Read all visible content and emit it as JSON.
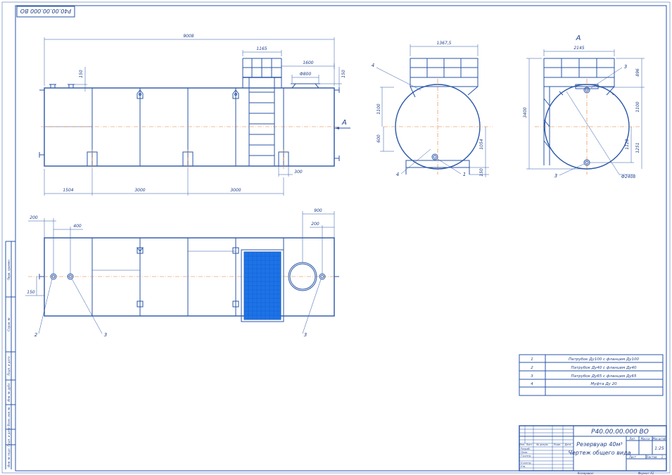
{
  "stamp_code": "Р40.00.00.000 ВО",
  "dimensions": {
    "total_length": "9008",
    "ladder_width": "1165",
    "platform_length": "1600",
    "hatch_dia": "Ф800",
    "top_left_150": "150",
    "top_right_150": "150",
    "support_300": "300",
    "bottom_1504": "1504",
    "bottom_3000_a": "3000",
    "bottom_3000_b": "3000",
    "mid_1367": "1367,5",
    "mid_1100": "1100",
    "mid_600": "600",
    "mid_1054": "1054",
    "mid_150": "150",
    "right_2145": "2145",
    "right_3400": "3400",
    "right_896": "896",
    "right_1100": "1100",
    "right_1120": "1120",
    "right_1251": "1251",
    "right_dia": "Ф2408",
    "plan_200a": "200",
    "plan_400": "400",
    "plan_900": "900",
    "plan_200b": "200",
    "plan_150": "150"
  },
  "section_letter": "А",
  "section_arrow_letter": "А",
  "callouts": {
    "mid_4_top": "4",
    "mid_4_bottom": "4",
    "mid_1": "1",
    "right_3_top": "3",
    "right_3_bottom": "3",
    "plan_2": "2",
    "plan_3a": "3",
    "plan_3b": "3"
  },
  "specification": [
    {
      "num": "1",
      "name": "Патрубок Ду100 с фланцем Ду100"
    },
    {
      "num": "2",
      "name": "Патрубок Ду40 с фланцем Ду40"
    },
    {
      "num": "3",
      "name": "Патрубок Ду65 с фланцем Ду65"
    },
    {
      "num": "4",
      "name": "Муфта Ду 20"
    }
  ],
  "title_block": {
    "code": "Р40.00.00.000 ВО",
    "name_line1": "Резервуар 40м³",
    "name_line2": "Чертеж общего вида",
    "col_lit": "Лит.",
    "col_mass": "Масса",
    "col_scale": "Масштаб",
    "scale": "1:25",
    "sheet": "Лист",
    "sheets": "Листов",
    "sheets_count": "1",
    "h_izm": "Изм.",
    "h_list": "Лист",
    "h_doc": "№ докум.",
    "h_sign": "Подп.",
    "h_date": "Дата",
    "r_razrab": "Разраб.",
    "r_prov": "Пров.",
    "r_tkontr": "Т.контр.",
    "r_nkontr": "Н.контр.",
    "r_utv": "Утв.",
    "copied": "Копировал",
    "format": "Формат   А1"
  },
  "side_strip": {
    "s1": "Перв. примен.",
    "s2": "Справ. №",
    "s3": "Подп. и дата",
    "s4": "Инв. № дубл.",
    "s5": "Взам. инв. №",
    "s6": "Подп. и дата",
    "s7": "Инв. № подл."
  }
}
